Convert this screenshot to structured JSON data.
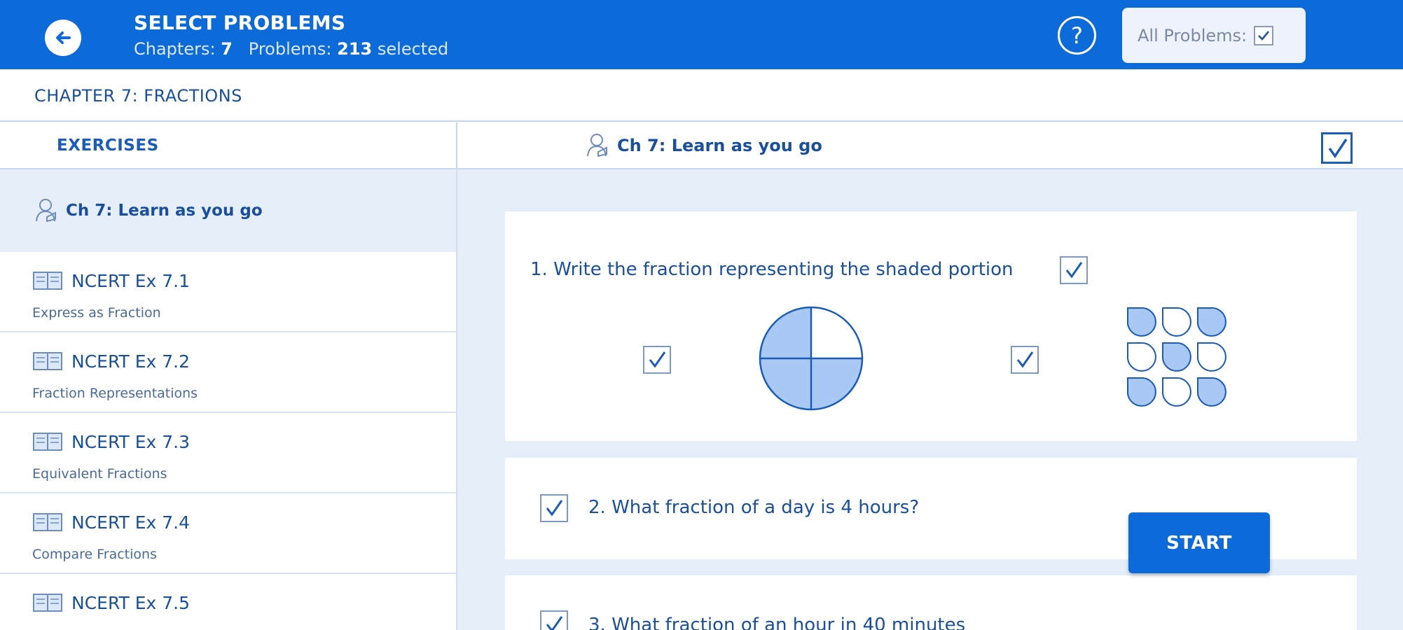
{
  "header": {
    "title": "SELECT PROBLEMS",
    "chapters_label": "Chapters:",
    "chapters_count": "7",
    "problems_label": "Problems:",
    "problems_count": "213",
    "selected_label": "selected",
    "help_symbol": "?",
    "all_problems_label": "All Problems:",
    "all_problems_checked": true
  },
  "chapter": {
    "title": "CHAPTER 7: FRACTIONS"
  },
  "section": {
    "tab_label": "EXERCISES",
    "title": "Ch 7: Learn as you go",
    "checked": true
  },
  "sidebar": {
    "header_title": "Ch 7: Learn as you go",
    "items": [
      {
        "name": "NCERT Ex 7.1",
        "subtitle": "Express as Fraction"
      },
      {
        "name": "NCERT Ex 7.2",
        "subtitle": "Fraction Representations"
      },
      {
        "name": "NCERT Ex 7.3",
        "subtitle": "Equivalent Fractions"
      },
      {
        "name": "NCERT Ex 7.4",
        "subtitle": "Compare Fractions"
      },
      {
        "name": "NCERT Ex 7.5",
        "subtitle": ""
      }
    ]
  },
  "questions": [
    {
      "text": "1. Write the fraction representing the shaded portion",
      "checked": true
    },
    {
      "text": "2. What fraction of a day is 4 hours?",
      "checked": true
    },
    {
      "text": "3. What fraction of an hour in 40 minutes",
      "checked": true
    }
  ],
  "figures": {
    "circle": {
      "parts": 4,
      "shaded": 3,
      "checked": true
    },
    "drops": {
      "parts": 9,
      "shaded": 5,
      "checked": true
    }
  },
  "start_button": {
    "label": "START"
  },
  "colors": {
    "primary": "#0d6ad9",
    "shade": "#a9c8f3",
    "text": "#1a4f9c",
    "panel": "#e6eefa"
  },
  "icons": {
    "back": "back-arrow-icon",
    "help": "help-icon",
    "learn": "learner-icon",
    "book": "book-icon",
    "check": "checkmark-icon"
  }
}
